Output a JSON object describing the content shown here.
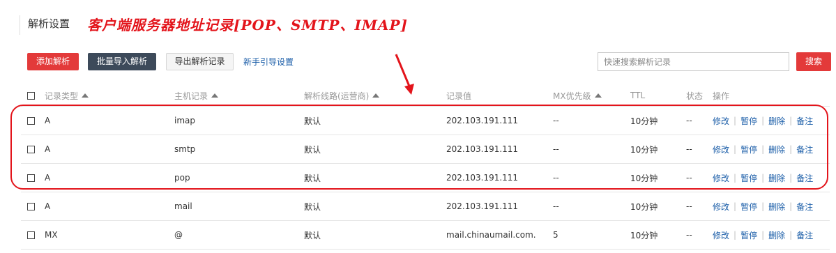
{
  "header": {
    "title": "解析设置",
    "annotation": "客户端服务器地址记录[POP、SMTP、IMAP]"
  },
  "toolbar": {
    "add_label": "添加解析",
    "batch_import_label": "批量导入解析",
    "export_label": "导出解析记录",
    "guide_label": "新手引导设置",
    "search_placeholder": "快速搜索解析记录",
    "search_button_label": "搜索"
  },
  "table": {
    "headers": {
      "type": "记录类型",
      "host": "主机记录",
      "line": "解析线路(运营商)",
      "value": "记录值",
      "mx": "MX优先级",
      "ttl": "TTL",
      "status": "状态",
      "ops": "操作"
    },
    "ops_labels": {
      "edit": "修改",
      "pause": "暂停",
      "delete": "删除",
      "note": "备注",
      "sep": "|"
    },
    "rows": [
      {
        "type": "A",
        "host": "imap",
        "line": "默认",
        "value": "202.103.191.111",
        "mx": "--",
        "ttl": "10分钟",
        "status": "--"
      },
      {
        "type": "A",
        "host": "smtp",
        "line": "默认",
        "value": "202.103.191.111",
        "mx": "--",
        "ttl": "10分钟",
        "status": "--"
      },
      {
        "type": "A",
        "host": "pop",
        "line": "默认",
        "value": "202.103.191.111",
        "mx": "--",
        "ttl": "10分钟",
        "status": "--"
      },
      {
        "type": "A",
        "host": "mail",
        "line": "默认",
        "value": "202.103.191.111",
        "mx": "--",
        "ttl": "10分钟",
        "status": "--"
      },
      {
        "type": "MX",
        "host": "@",
        "line": "默认",
        "value": "mail.chinaumail.com.",
        "mx": "5",
        "ttl": "10分钟",
        "status": "--"
      }
    ]
  },
  "colors": {
    "accent_red": "#e33a3a",
    "dark_button": "#3d4a5a",
    "link_blue": "#1a5da8",
    "annotation_red": "#e3141b"
  }
}
